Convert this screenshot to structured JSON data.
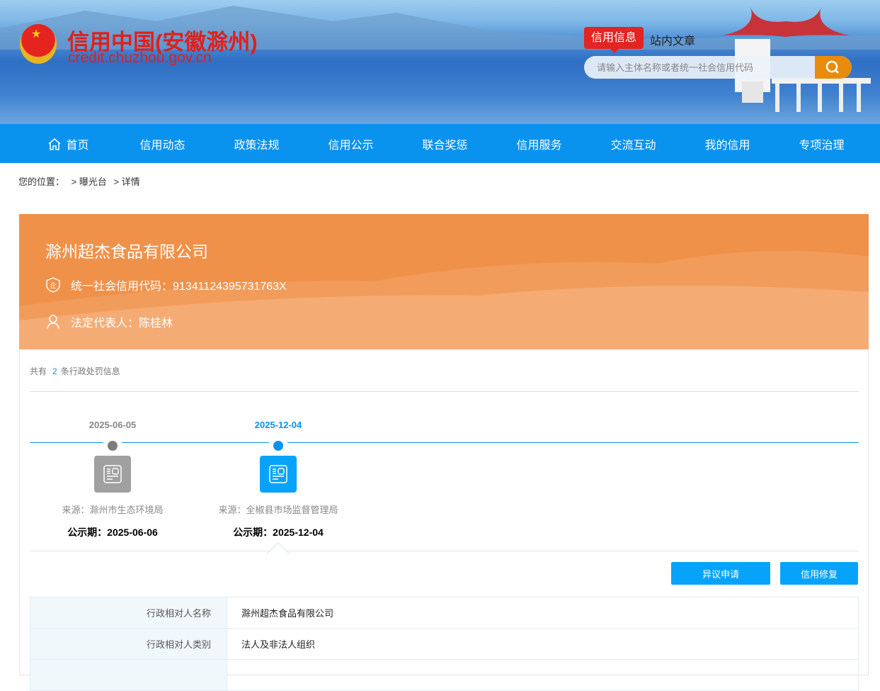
{
  "header": {
    "site_title": "信用中国(安徽滁州)",
    "site_url": "credit.chuzhou.gov.cn",
    "search_tabs": [
      "信用信息",
      "站内文章"
    ],
    "search_placeholder": "请输入主体名称或者统一社会信用代码"
  },
  "nav": [
    "首页",
    "信用动态",
    "政策法规",
    "信用公示",
    "联合奖惩",
    "信用服务",
    "交流互动",
    "我的信用",
    "专项治理"
  ],
  "breadcrumb": {
    "label": "您的位置：",
    "items": [
      "> 曝光台",
      "> 详情"
    ]
  },
  "company": {
    "name": "滁州超杰食品有限公司",
    "credit_code_label": "统一社会信用代码：",
    "credit_code": "91341124395731763X",
    "legal_rep_label": "法定代表人：",
    "legal_rep": "陈桂林"
  },
  "summary": {
    "prefix": "共有",
    "count": "2",
    "suffix": "条行政处罚信息"
  },
  "timeline": [
    {
      "date": "2025-06-05",
      "source": "来源：滁州市生态环境局",
      "public": "公示期：2025-06-06",
      "active": false
    },
    {
      "date": "2025-12-04",
      "source": "来源：全椒县市场监督管理局",
      "public": "公示期：2025-12-04",
      "active": true
    }
  ],
  "buttons": {
    "objection": "异议申请",
    "repair": "信用修复"
  },
  "details": [
    {
      "key": "行政相对人名称",
      "value": "滁州超杰食品有限公司"
    },
    {
      "key": "行政相对人类别",
      "value": "法人及非法人组织"
    },
    {
      "key": "",
      "value": ""
    }
  ],
  "colors": {
    "brand_red": "#e0201a",
    "nav_blue": "#0a92ef",
    "hero_orange": "#f0914a",
    "search_orange": "#e98c0c"
  }
}
